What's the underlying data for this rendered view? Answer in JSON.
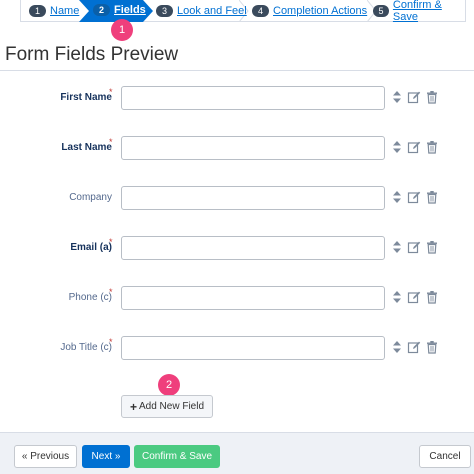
{
  "wizard": {
    "steps": [
      {
        "num": "1",
        "label": "Name"
      },
      {
        "num": "2",
        "label": "Fields"
      },
      {
        "num": "3",
        "label": "Look and Feel"
      },
      {
        "num": "4",
        "label": "Completion Actions"
      },
      {
        "num": "5",
        "label": "Confirm & Save"
      }
    ],
    "active_step": "Fields"
  },
  "badges": {
    "one": "1",
    "two": "2"
  },
  "page": {
    "title": "Form Fields Preview"
  },
  "fields": [
    {
      "label": "First Name",
      "required": "*"
    },
    {
      "label": "Last Name",
      "required": "*"
    },
    {
      "label": "Company",
      "required": ""
    },
    {
      "label": "Email (a)",
      "required": "*"
    },
    {
      "label": "Phone (c)",
      "required": "*"
    },
    {
      "label": "Job Title (c)",
      "required": "*"
    }
  ],
  "add_field": {
    "plus": "+",
    "label": "Add New Field"
  },
  "footer": {
    "previous": "« Previous",
    "next": "Next »",
    "confirm": "Confirm & Save",
    "cancel": "Cancel"
  },
  "colors": {
    "accent": "#0070d2",
    "success": "#4bca81",
    "badge": "#ef3f7c",
    "required_star": "#c23934"
  },
  "icons": [
    "reorder-icon",
    "edit-icon",
    "delete-icon"
  ]
}
